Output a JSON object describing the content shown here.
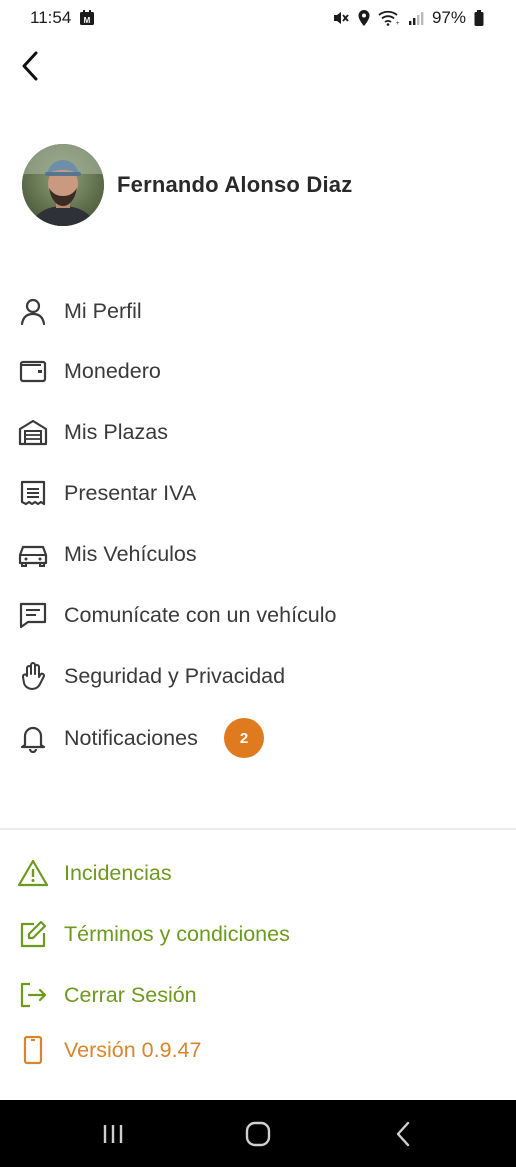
{
  "status_bar": {
    "time": "11:54",
    "battery": "97%"
  },
  "profile": {
    "name": "Fernando Alonso Diaz"
  },
  "menu": {
    "items": [
      {
        "label": "Mi Perfil",
        "icon": "user-icon"
      },
      {
        "label": "Monedero",
        "icon": "wallet-icon"
      },
      {
        "label": "Mis Plazas",
        "icon": "garage-icon"
      },
      {
        "label": "Presentar IVA",
        "icon": "receipt-icon"
      },
      {
        "label": "Mis Vehículos",
        "icon": "car-icon"
      },
      {
        "label": "Comunícate con un vehículo",
        "icon": "message-icon"
      },
      {
        "label": "Seguridad y Privacidad",
        "icon": "hand-icon"
      },
      {
        "label": "Notificaciones",
        "icon": "bell-icon",
        "badge": "2"
      }
    ]
  },
  "secondary_menu": {
    "items": [
      {
        "label": "Incidencias",
        "icon": "warning-icon"
      },
      {
        "label": "Términos y condiciones",
        "icon": "edit-icon"
      },
      {
        "label": "Cerrar Sesión",
        "icon": "logout-icon"
      },
      {
        "label": "Versión 0.9.47",
        "icon": "phone-icon"
      }
    ]
  },
  "colors": {
    "accent_green": "#6d9a1e",
    "accent_orange": "#d9852b",
    "badge": "#e07a1f",
    "text": "#3a3a3a"
  }
}
